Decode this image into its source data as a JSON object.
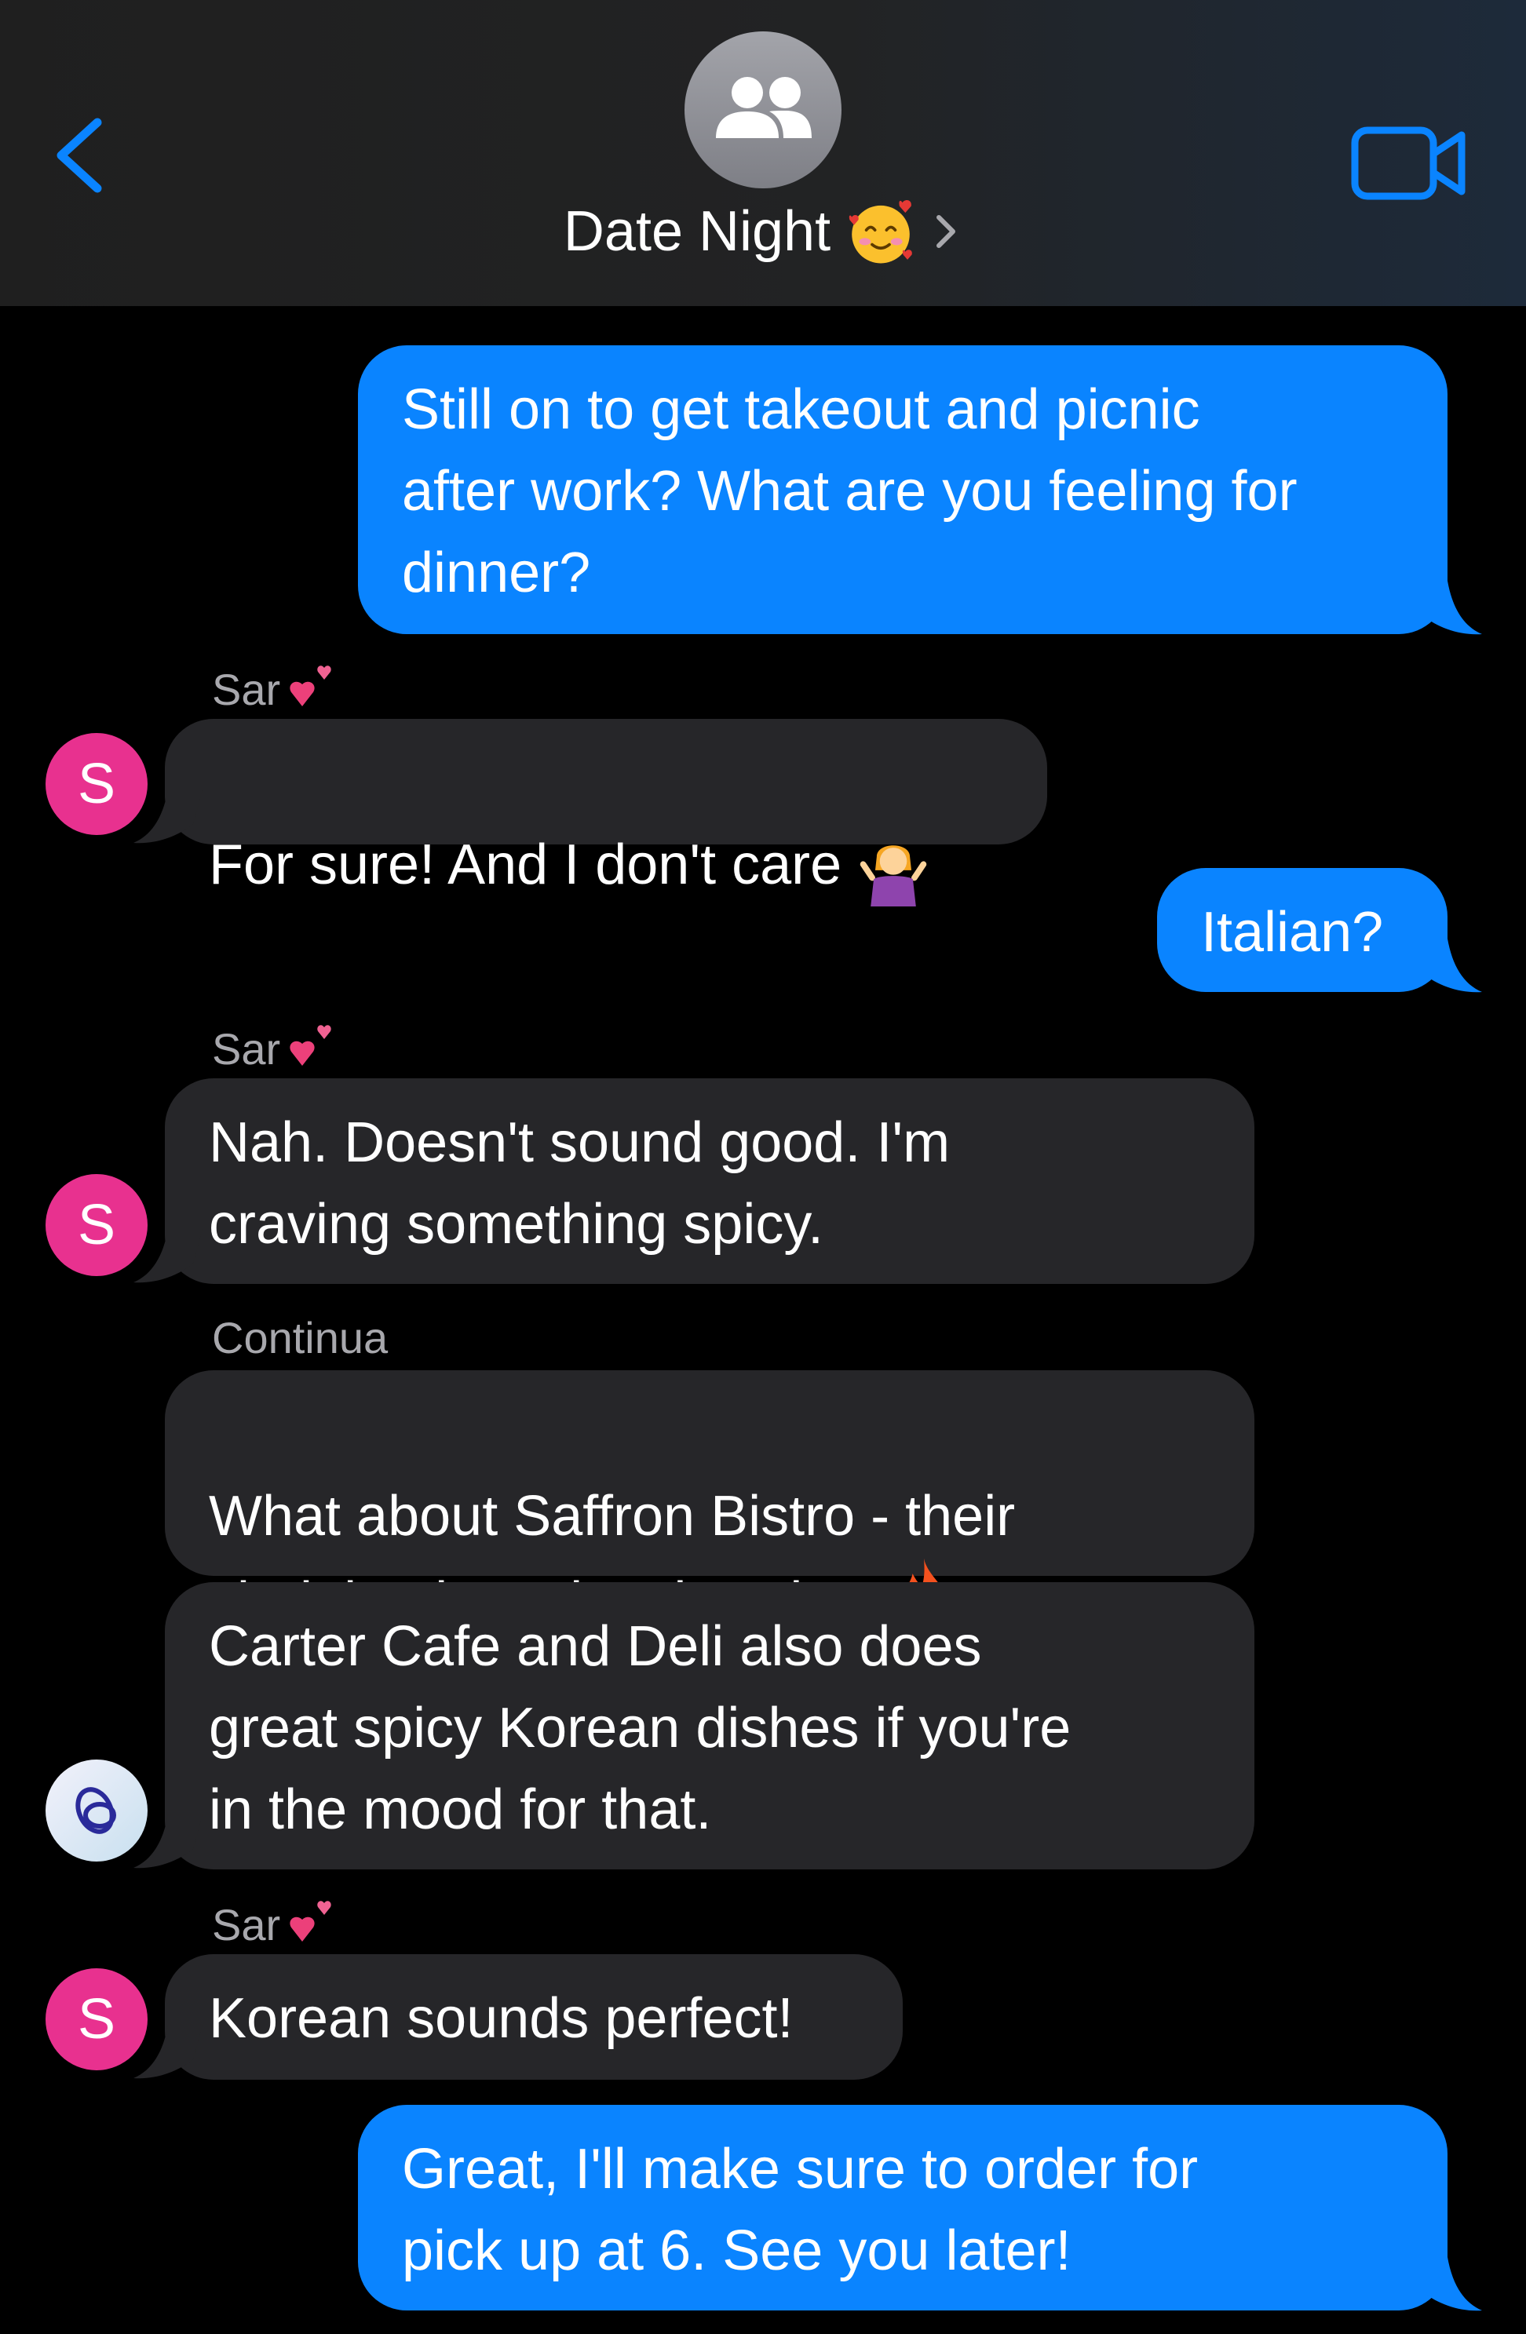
{
  "header": {
    "title": "Date Night",
    "title_emoji": "smiling-face-with-hearts",
    "colors": {
      "accent": "#0a84ff"
    }
  },
  "messages": [
    {
      "id": "m1",
      "direction": "outgoing",
      "text": "Still on to get takeout and picnic\nafter work? What are you feeling for\ndinner?"
    },
    {
      "id": "m2",
      "direction": "incoming",
      "sender": "Sar",
      "sender_emoji": "two-hearts",
      "avatar_letter": "S",
      "text": "For sure! And I don't care",
      "emoji": "person-shrugging"
    },
    {
      "id": "m3",
      "direction": "outgoing",
      "text": "Italian?"
    },
    {
      "id": "m4",
      "direction": "incoming",
      "sender": "Sar",
      "sender_emoji": "two-hearts",
      "avatar_letter": "S",
      "text": "Nah. Doesn't sound good. I'm\ncraving something spicy."
    },
    {
      "id": "m5",
      "direction": "incoming",
      "sender": "Continua",
      "text": "What about Saffron Bistro - their\nvindaloo is seriously spicy!",
      "emoji": "fire"
    },
    {
      "id": "m6",
      "direction": "incoming",
      "avatar": "continua-logo",
      "text": "Carter Cafe and Deli also does\ngreat spicy Korean dishes if you're\nin the mood for that."
    },
    {
      "id": "m7",
      "direction": "incoming",
      "sender": "Sar",
      "sender_emoji": "two-hearts",
      "avatar_letter": "S",
      "text": "Korean sounds perfect!"
    },
    {
      "id": "m8",
      "direction": "outgoing",
      "text": "Great, I'll make sure to order for\npick up at 6. See you later!"
    }
  ]
}
